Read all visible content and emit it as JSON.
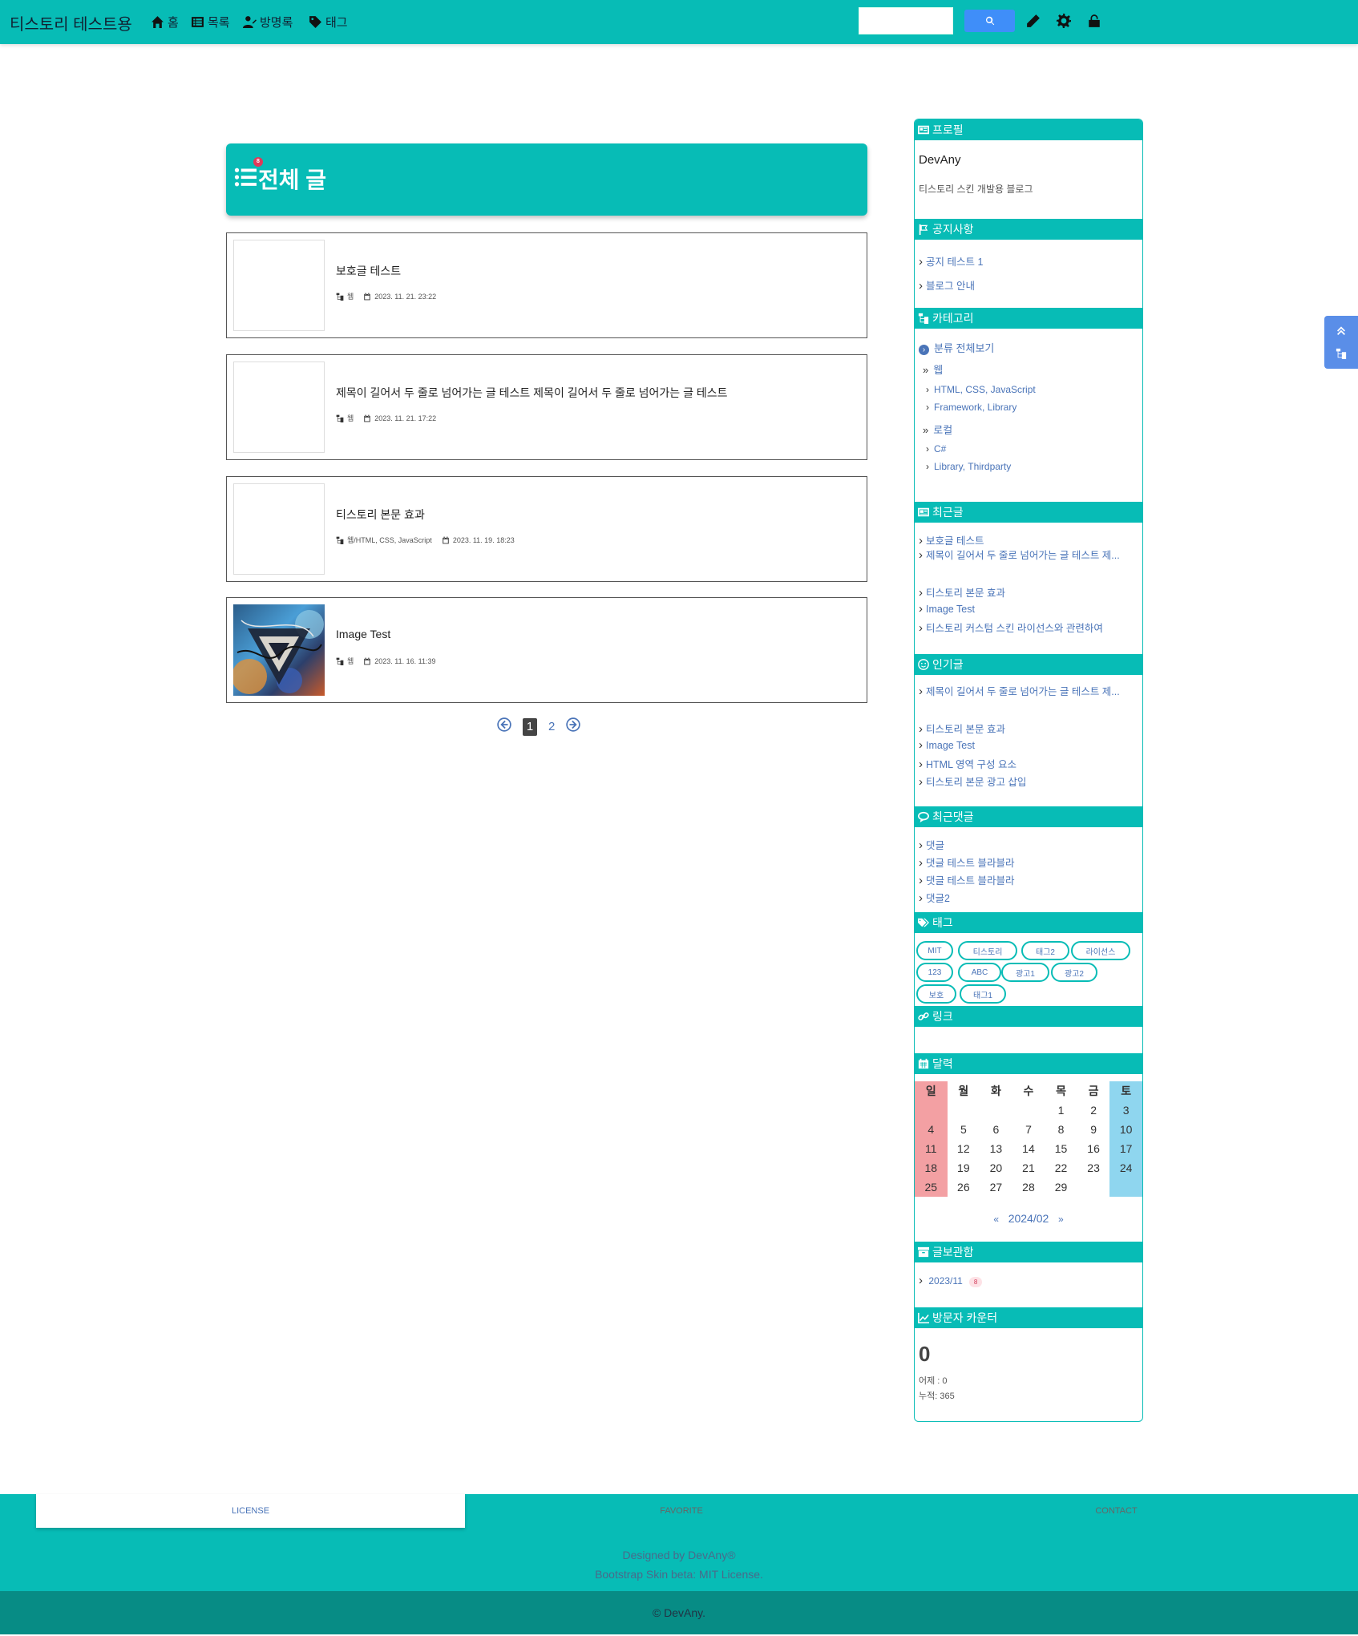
{
  "navbar": {
    "brand": "티스토리 테스트용",
    "items": [
      {
        "label": "홈",
        "icon": "home-icon"
      },
      {
        "label": "목록",
        "icon": "list-icon"
      },
      {
        "label": "방명록",
        "icon": "guestbook-icon"
      },
      {
        "label": "태그",
        "icon": "tag-icon"
      }
    ],
    "search_placeholder": "",
    "tools": [
      "write-icon",
      "settings-icon",
      "unlock-icon"
    ]
  },
  "list": {
    "title": "전체 글",
    "count_badge": "8"
  },
  "posts": [
    {
      "title": "보호글 테스트",
      "category": "웹",
      "date": "2023. 11. 21. 23:22",
      "has_image": false
    },
    {
      "title": "제목이 길어서 두 줄로 넘어가는 글 테스트 제목이 길어서 두 줄로 넘어가는 글 테스트",
      "category": "웹",
      "date": "2023. 11. 21. 17:22",
      "has_image": false
    },
    {
      "title": "티스토리 본문 효과",
      "category": "웹/HTML, CSS, JavaScript",
      "date": "2023. 11. 19. 18:23",
      "has_image": false
    },
    {
      "title": "Image Test",
      "category": "웹",
      "date": "2023. 11. 16. 11:39",
      "has_image": true
    }
  ],
  "pagination": {
    "pages": [
      "1",
      "2"
    ],
    "current": "1"
  },
  "sidebar": {
    "profile": {
      "heading": "프로필",
      "name": "DevAny",
      "desc": "티스토리 스킨 개발용 블로그"
    },
    "notice": {
      "heading": "공지사항",
      "items": [
        "공지 테스트 1",
        "블로그 안내"
      ]
    },
    "category": {
      "heading": "카테고리",
      "all": "분류 전체보기",
      "groups": [
        {
          "name": "웹",
          "children": [
            "HTML, CSS, JavaScript",
            "Framework, Library"
          ]
        },
        {
          "name": "로컬",
          "children": [
            "C#",
            "Library, Thirdparty"
          ]
        }
      ]
    },
    "recent": {
      "heading": "최근글",
      "items": [
        "보호글 테스트",
        "제목이 길어서 두 줄로 넘어가는 글 테스트 제...",
        "티스토리 본문 효과",
        "Image Test",
        "티스토리 커스텀 스킨 라이선스와 관련하여"
      ]
    },
    "popular": {
      "heading": "인기글",
      "items": [
        "제목이 길어서 두 줄로 넘어가는 글 테스트 제...",
        "티스토리 본문 효과",
        "Image Test",
        "HTML 영역 구성 요소",
        "티스토리 본문 광고 삽입"
      ]
    },
    "comments": {
      "heading": "최근댓글",
      "items": [
        "댓글",
        "댓글 테스트 블라블라",
        "댓글 테스트 블라블라",
        "댓글2"
      ]
    },
    "tags": {
      "heading": "태그",
      "items": [
        "MIT",
        "티스토리",
        "태그2",
        "라이선스",
        "123",
        "ABC",
        "광고1",
        "광고2",
        "보호",
        "태그1"
      ]
    },
    "links": {
      "heading": "링크"
    },
    "calendar": {
      "heading": "달력",
      "weekdays": [
        "일",
        "월",
        "화",
        "수",
        "목",
        "금",
        "토"
      ],
      "weeks": [
        [
          "",
          "",
          "",
          "",
          "1",
          "2",
          "3"
        ],
        [
          "4",
          "5",
          "6",
          "7",
          "8",
          "9",
          "10"
        ],
        [
          "11",
          "12",
          "13",
          "14",
          "15",
          "16",
          "17"
        ],
        [
          "18",
          "19",
          "20",
          "21",
          "22",
          "23",
          "24"
        ],
        [
          "25",
          "26",
          "27",
          "28",
          "29",
          "",
          ""
        ]
      ],
      "prev": "«",
      "month": "2024/02",
      "next": "»"
    },
    "archive": {
      "heading": "글보관함",
      "items": [
        {
          "label": "2023/11",
          "count": "8"
        }
      ]
    },
    "visitors": {
      "heading": "방문자 카운터",
      "today": "0",
      "yesterday": "어제 : 0",
      "total": "누적: 365"
    }
  },
  "footer": {
    "tabs": [
      "LICENSE",
      "FAVORITE",
      "CONTACT"
    ],
    "line1": "Designed by DevAny®",
    "line2": "Bootstrap Skin beta: MIT License.",
    "copyright": "© DevAny."
  },
  "colors": {
    "accent": "#07bcb6",
    "link": "#4a74b8",
    "button": "#3f8ef9",
    "sunday": "#f3a0a3",
    "saturday": "#8fd6ef"
  }
}
